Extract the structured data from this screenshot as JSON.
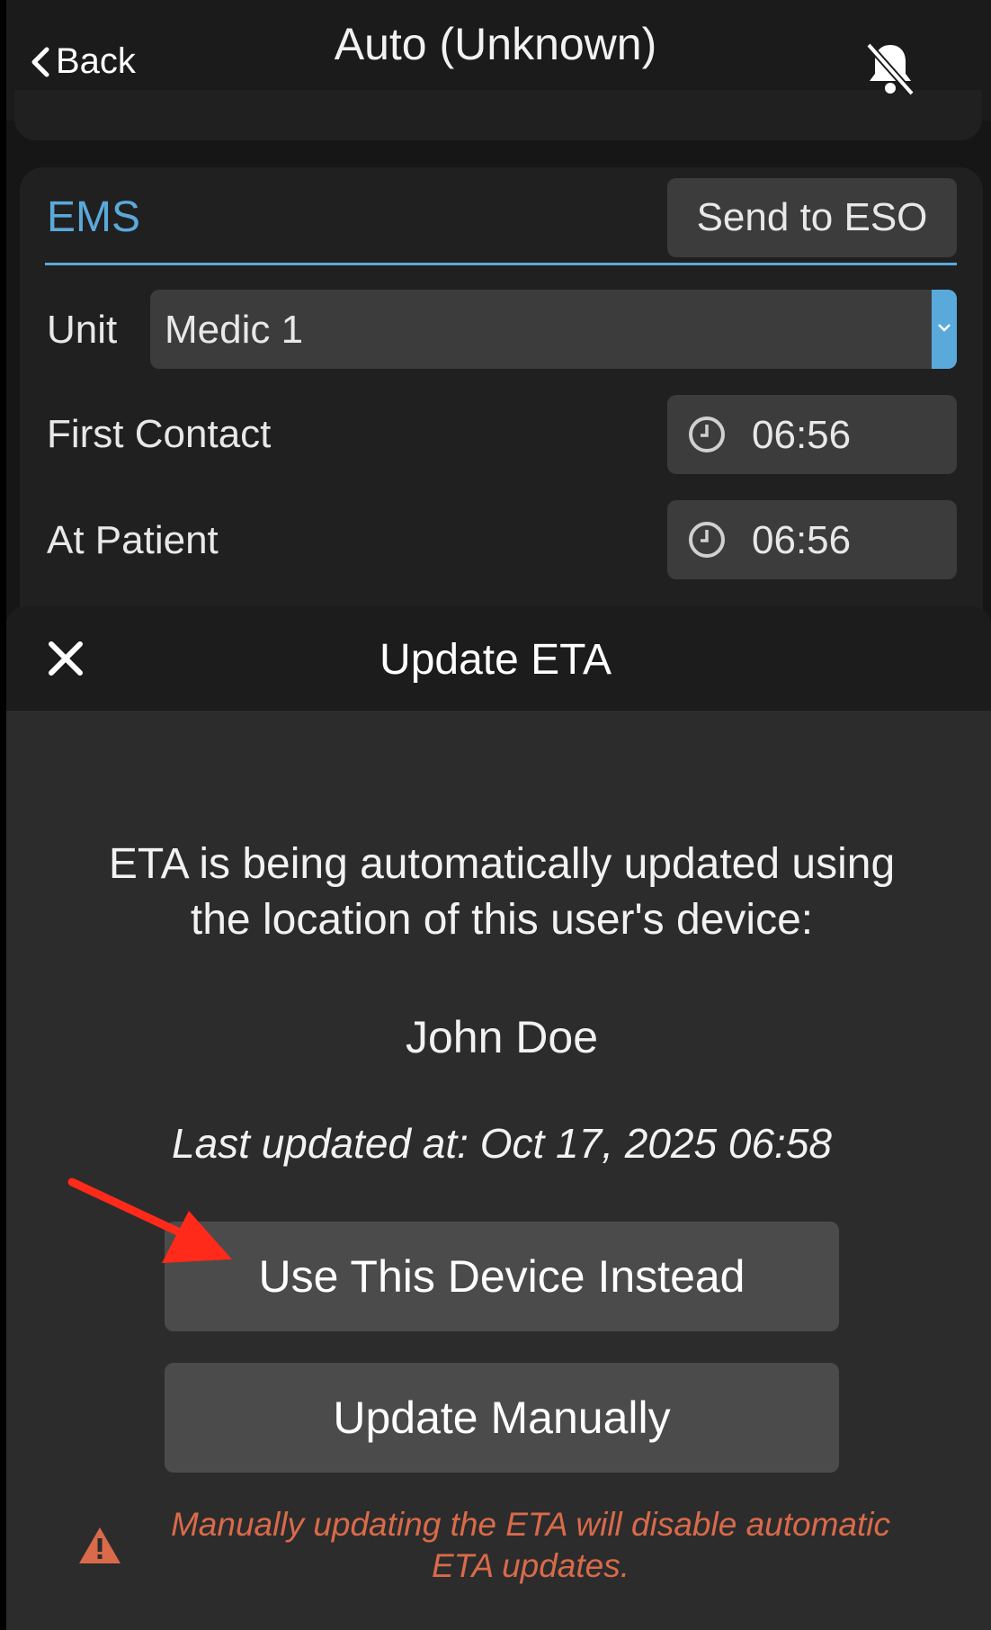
{
  "header": {
    "back_label": "Back",
    "title": "Auto (Unknown)",
    "bell_icon": "bell-off-icon"
  },
  "ems": {
    "section_label": "EMS",
    "send_button": "Send to ESO",
    "unit_label": "Unit",
    "unit_value": "Medic 1",
    "first_contact_label": "First Contact",
    "first_contact_time": "06:56",
    "at_patient_label": "At Patient",
    "at_patient_time": "06:56"
  },
  "modal": {
    "title": "Update ETA",
    "close_icon": "close-icon",
    "message_line1": "ETA is being automatically updated using",
    "message_line2": "the location of this user's device:",
    "user_name": "John Doe",
    "last_updated": "Last updated at: Oct 17, 2025 06:58",
    "use_device_button": "Use This Device Instead",
    "update_manually_button": "Update Manually",
    "warning_line1": "Manually updating the ETA will disable automatic",
    "warning_line2": "ETA updates."
  },
  "colors": {
    "accent": "#5aa9db",
    "warning": "#d96a4a",
    "annotation_arrow": "#ff2a1a"
  }
}
